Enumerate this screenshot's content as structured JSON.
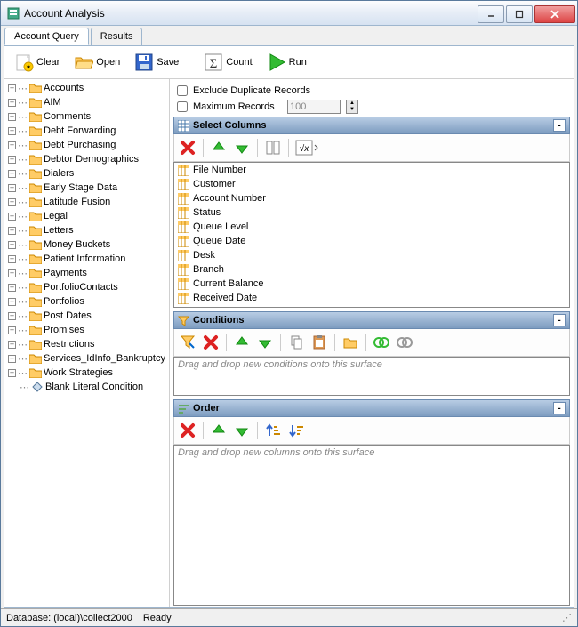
{
  "window": {
    "title": "Account Analysis"
  },
  "tabs": [
    {
      "label": "Account Query",
      "active": true
    },
    {
      "label": "Results",
      "active": false
    }
  ],
  "toolbar": {
    "clear": "Clear",
    "open": "Open",
    "save": "Save",
    "count": "Count",
    "run": "Run"
  },
  "tree": [
    "Accounts",
    "AIM",
    "Comments",
    "Debt Forwarding",
    "Debt Purchasing",
    "Debtor Demographics",
    "Dialers",
    "Early Stage Data",
    "Latitude Fusion",
    "Legal",
    "Letters",
    "Money Buckets",
    "Patient Information",
    "Payments",
    "PortfolioContacts",
    "Portfolios",
    "Post Dates",
    "Promises",
    "Restrictions",
    "Services_IdInfo_Bankruptcy",
    "Work Strategies"
  ],
  "tree_special": {
    "label": "Blank Literal Condition"
  },
  "options": {
    "exclude_label": "Exclude Duplicate Records",
    "max_label": "Maximum Records",
    "max_value": "100"
  },
  "sections": {
    "columns": {
      "title": "Select Columns",
      "items": [
        "File Number",
        "Customer",
        "Account Number",
        "Status",
        "Queue Level",
        "Queue Date",
        "Desk",
        "Branch",
        "Current Balance",
        "Received Date"
      ]
    },
    "conditions": {
      "title": "Conditions",
      "placeholder": "Drag and drop new conditions onto this surface"
    },
    "order": {
      "title": "Order",
      "placeholder": "Drag and drop new columns onto this surface"
    }
  },
  "status": {
    "db": "Database: (local)\\collect2000",
    "state": "Ready"
  }
}
